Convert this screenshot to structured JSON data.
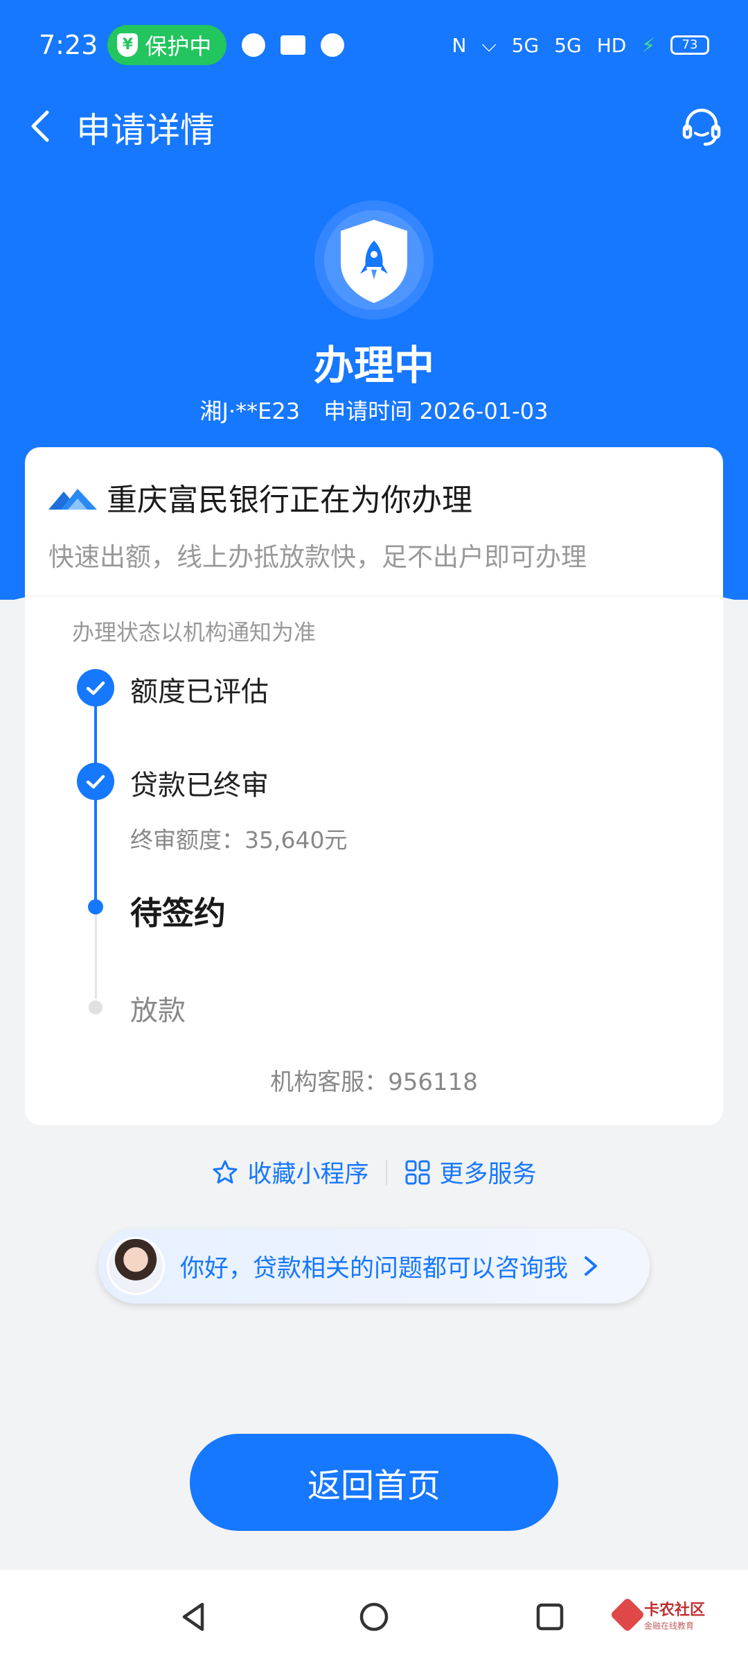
{
  "status_bar": {
    "time": "7:23",
    "protect_label": "保护中",
    "network": "5G",
    "hd_label": "HD",
    "battery": "73"
  },
  "nav": {
    "title": "申请详情"
  },
  "hero": {
    "status": "办理中",
    "plate": "湘J·**E23",
    "apply_time": "申请时间 2026-01-03"
  },
  "card": {
    "bank_name": "重庆富民银行正在为你办理",
    "description": "快速出额，线上办抵放款快，足不出户即可办理",
    "notice": "办理状态以机构通知为准",
    "steps": [
      {
        "label": "额度已评估",
        "state": "done"
      },
      {
        "label": "贷款已终审",
        "state": "done",
        "sub": "终审额度：35,640元"
      },
      {
        "label": "待签约",
        "state": "current"
      },
      {
        "label": "放款",
        "state": "pending"
      }
    ],
    "service": "机构客服：956118"
  },
  "links": {
    "favorite": "收藏小程序",
    "more": "更多服务"
  },
  "assistant": {
    "text": "你好，贷款相关的问题都可以咨询我"
  },
  "home_button": "返回首页",
  "watermark": {
    "title": "卡农社区",
    "subtitle": "金融在线教育"
  },
  "colors": {
    "primary": "#1677ff",
    "protect_green": "#22c55e"
  }
}
